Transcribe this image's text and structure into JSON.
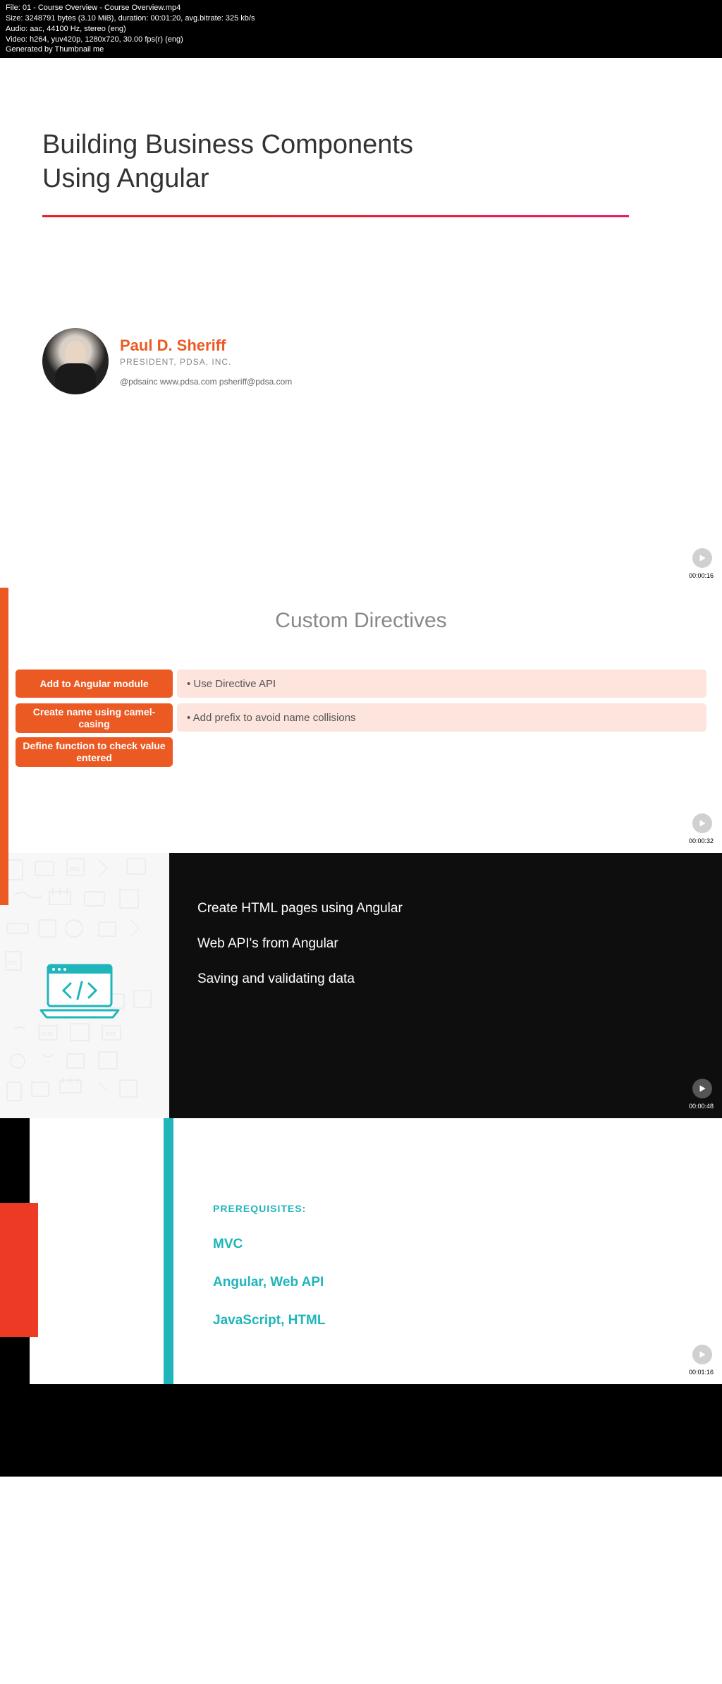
{
  "header": {
    "file": "File: 01 - Course Overview - Course Overview.mp4",
    "size": "Size: 3248791 bytes (3.10 MiB), duration: 00:01:20, avg.bitrate: 325 kb/s",
    "audio": "Audio: aac, 44100 Hz, stereo (eng)",
    "video": "Video: h264, yuv420p, 1280x720, 30.00 fps(r) (eng)",
    "generated": "Generated by Thumbnail me"
  },
  "slide1": {
    "title_line1": "Building Business Components",
    "title_line2": "Using Angular"
  },
  "slide2": {
    "author_name": "Paul D. Sheriff",
    "author_title": "PRESIDENT, PDSA, INC.",
    "contact": "@pdsainc   www.pdsa.com    psheriff@pdsa.com",
    "timestamp": "00:00:16"
  },
  "slide3": {
    "title": "Custom Directives",
    "rows": [
      {
        "left": "Add to Angular module",
        "right": "• Use Directive API"
      },
      {
        "left": "Create name using camel-casing",
        "right": "• Add prefix to avoid name collisions"
      },
      {
        "left": "Define function to check value entered",
        "right": ""
      }
    ],
    "timestamp": "00:00:32"
  },
  "slide4": {
    "lines": [
      "Create HTML pages using Angular",
      "Web API's from Angular",
      "Saving and validating data"
    ],
    "timestamp": "00:00:48"
  },
  "slide5": {
    "label": "PREREQUISITES:",
    "items": [
      "MVC",
      "Angular, Web API",
      "JavaScript, HTML"
    ],
    "timestamp": "00:01:16"
  }
}
